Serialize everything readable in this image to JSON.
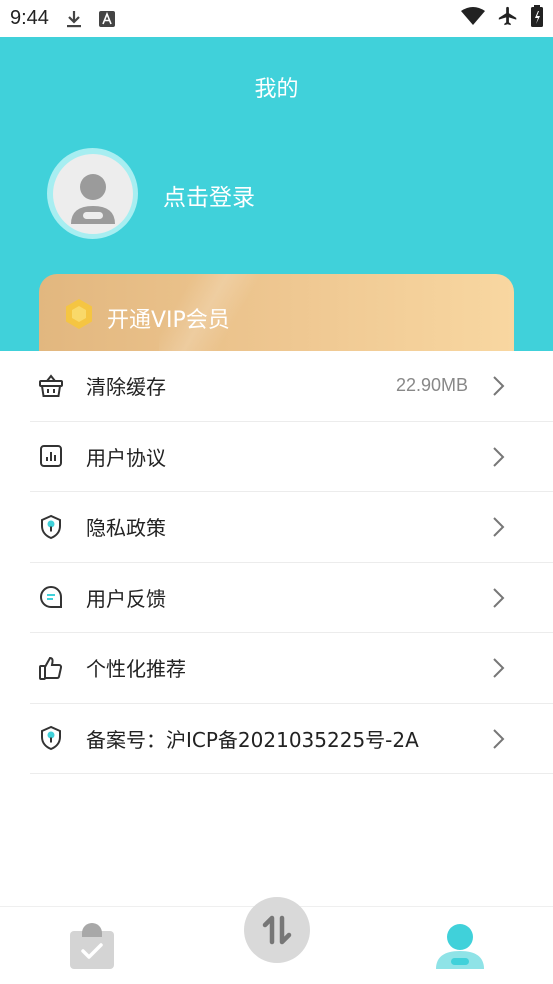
{
  "status_bar": {
    "time": "9:44"
  },
  "header": {
    "title": "我的",
    "login_label": "点击登录",
    "vip_label": "开通VIP会员"
  },
  "menu": {
    "items": [
      {
        "label": "清除缓存",
        "value": "22.90MB",
        "icon": "basket-icon"
      },
      {
        "label": "用户协议",
        "icon": "chart-doc-icon"
      },
      {
        "label": "隐私政策",
        "icon": "shield-key-icon"
      },
      {
        "label": "用户反馈",
        "icon": "chat-bubble-icon"
      },
      {
        "label": "个性化推荐",
        "icon": "thumbs-up-icon"
      },
      {
        "label": "备案号：沪ICP备2021035225号-2A",
        "icon": "shield-key-icon"
      }
    ]
  },
  "bottom_nav": {
    "items": [
      "clipboard-check-icon",
      "swap-arrows-icon",
      "profile-icon"
    ],
    "active": "profile-icon"
  },
  "colors": {
    "accent": "#40d1da",
    "vip_gold": "#efc892",
    "text": "#222222",
    "muted": "#888888"
  }
}
